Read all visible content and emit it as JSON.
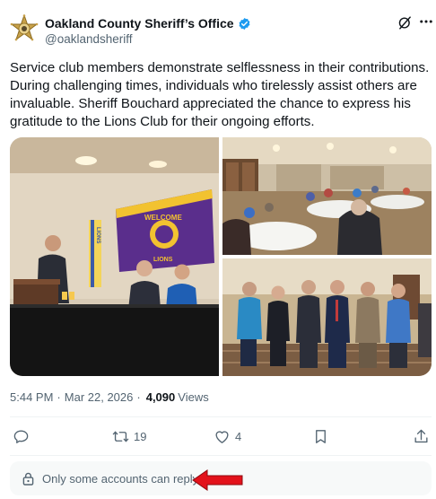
{
  "author": {
    "display_name": "Oakland County Sheriff’s Office",
    "handle": "@oaklandsheriff",
    "verified": true,
    "avatar_icon": "sheriff-star-badge-icon"
  },
  "post": {
    "text": "Service club members demonstrate selflessness in their contributions. During challenging times, individuals who tirelessly assist others are invaluable. Sheriff Bouchard appreciated the chance to express his gratitude to the Lions Club for their ongoing efforts.",
    "time": "5:44 PM",
    "date": "Mar 22, 2026",
    "views_count": "4,090",
    "views_label": "Views"
  },
  "media": {
    "banner_text_1": "WELCOME",
    "banner_text_2": "LIONS",
    "flag_text": "LIONS"
  },
  "actions": {
    "reply_count": "",
    "repost_count": "19",
    "like_count": "4"
  },
  "reply_restriction": "Only some accounts can reply.",
  "colors": {
    "verified_blue": "#1d9bf0",
    "muted_text": "#536471",
    "annotation_red": "#e3121b"
  }
}
